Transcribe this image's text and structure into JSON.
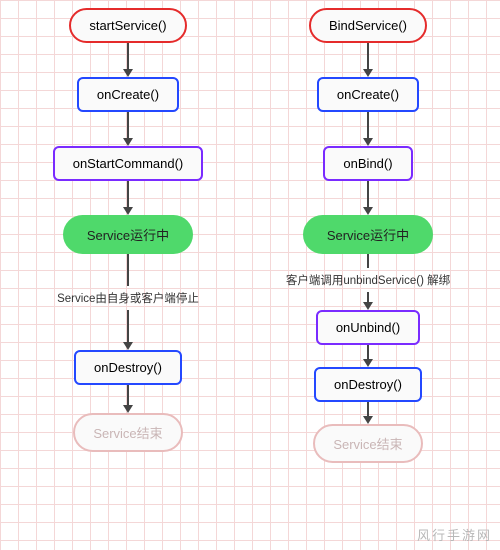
{
  "watermark": "风行手游网",
  "left": {
    "start": "startService()",
    "onCreate": "onCreate()",
    "onStartCommand": "onStartCommand()",
    "running": "Service运行中",
    "stopNote": "Service由自身或客户端停止",
    "onDestroy": "onDestroy()",
    "end": "Service结束"
  },
  "right": {
    "start": "BindService()",
    "onCreate": "onCreate()",
    "onBind": "onBind()",
    "running": "Service运行中",
    "unbindNote": "客户端调用unbindService() 解绑",
    "onUnbind": "onUnbind()",
    "onDestroy": "onDestroy()",
    "end": "Service结束"
  }
}
